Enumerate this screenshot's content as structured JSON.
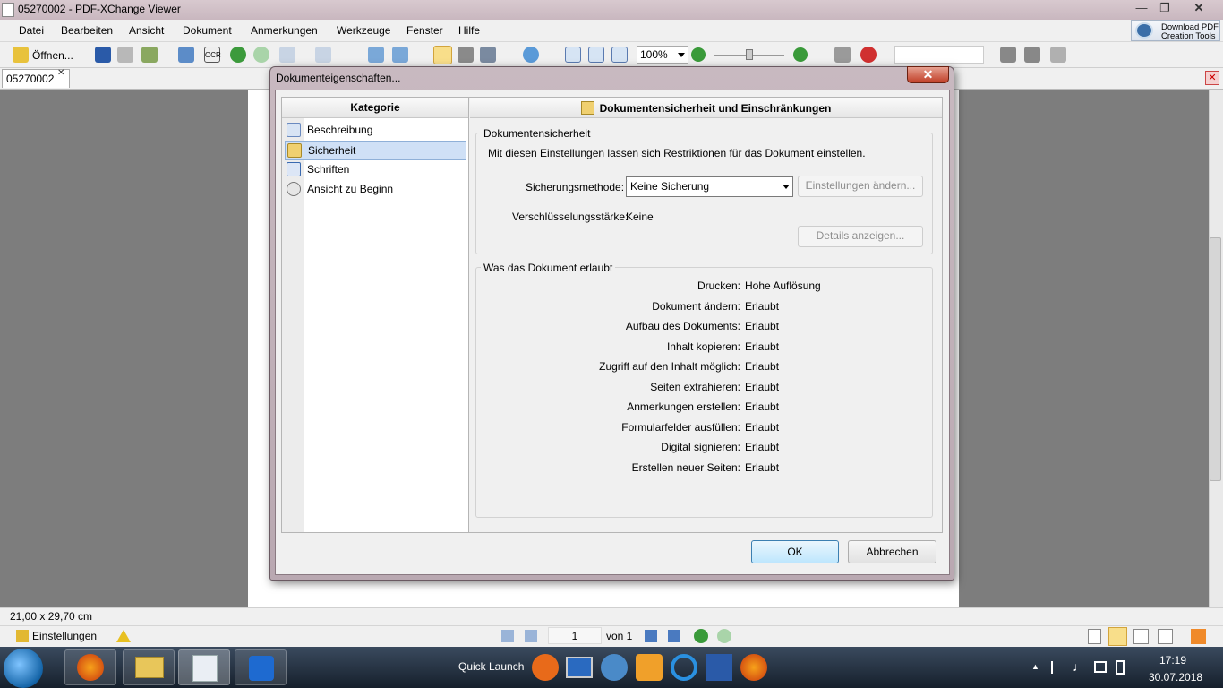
{
  "window": {
    "title": "05270002 - PDF-XChange Viewer"
  },
  "menu": [
    "Datei",
    "Bearbeiten",
    "Ansicht",
    "Dokument",
    "Anmerkungen",
    "Werkzeuge",
    "Fenster",
    "Hilfe"
  ],
  "download_button": {
    "line1": "Download PDF",
    "line2": "Creation Tools"
  },
  "toolbar": {
    "open_label": "Öffnen...",
    "ocr_label": "OCR",
    "zoom": "100%"
  },
  "doc_tab": {
    "label": "05270002"
  },
  "status": {
    "page_size": "21,00 x 29,70 cm",
    "settings_label": "Einstellungen",
    "page_current": "1",
    "page_of": "von 1"
  },
  "taskbar": {
    "quick_launch": "Quick Launch",
    "time": "17:19",
    "date": "30.07.2018"
  },
  "dialog": {
    "title": "Dokumenteigenschaften...",
    "category_header": "Kategorie",
    "categories": [
      "Beschreibung",
      "Sicherheit",
      "Schriften",
      "Ansicht zu Beginn"
    ],
    "selected_category": "Sicherheit",
    "panel_header": "Dokumentensicherheit und Einschränkungen",
    "security_group": {
      "title": "Dokumentensicherheit",
      "description": "Mit diesen Einstellungen lassen sich Restriktionen für das Dokument einstellen.",
      "method_label": "Sicherungsmethode:",
      "method_value": "Keine Sicherung",
      "change_settings_button": "Einstellungen ändern...",
      "encryption_label": "Verschlüsselungsstärke:",
      "encryption_value": "Keine",
      "details_button": "Details anzeigen..."
    },
    "permissions_group": {
      "title": "Was das Dokument erlaubt",
      "rows": [
        {
          "label": "Drucken:",
          "value": "Hohe Auflösung"
        },
        {
          "label": "Dokument ändern:",
          "value": "Erlaubt"
        },
        {
          "label": "Aufbau des Dokuments:",
          "value": "Erlaubt"
        },
        {
          "label": "Inhalt kopieren:",
          "value": "Erlaubt"
        },
        {
          "label": "Zugriff auf den Inhalt möglich:",
          "value": "Erlaubt"
        },
        {
          "label": "Seiten extrahieren:",
          "value": "Erlaubt"
        },
        {
          "label": "Anmerkungen erstellen:",
          "value": "Erlaubt"
        },
        {
          "label": "Formularfelder ausfüllen:",
          "value": "Erlaubt"
        },
        {
          "label": "Digital signieren:",
          "value": "Erlaubt"
        },
        {
          "label": "Erstellen neuer Seiten:",
          "value": "Erlaubt"
        }
      ]
    },
    "ok_button": "OK",
    "cancel_button": "Abbrechen"
  }
}
